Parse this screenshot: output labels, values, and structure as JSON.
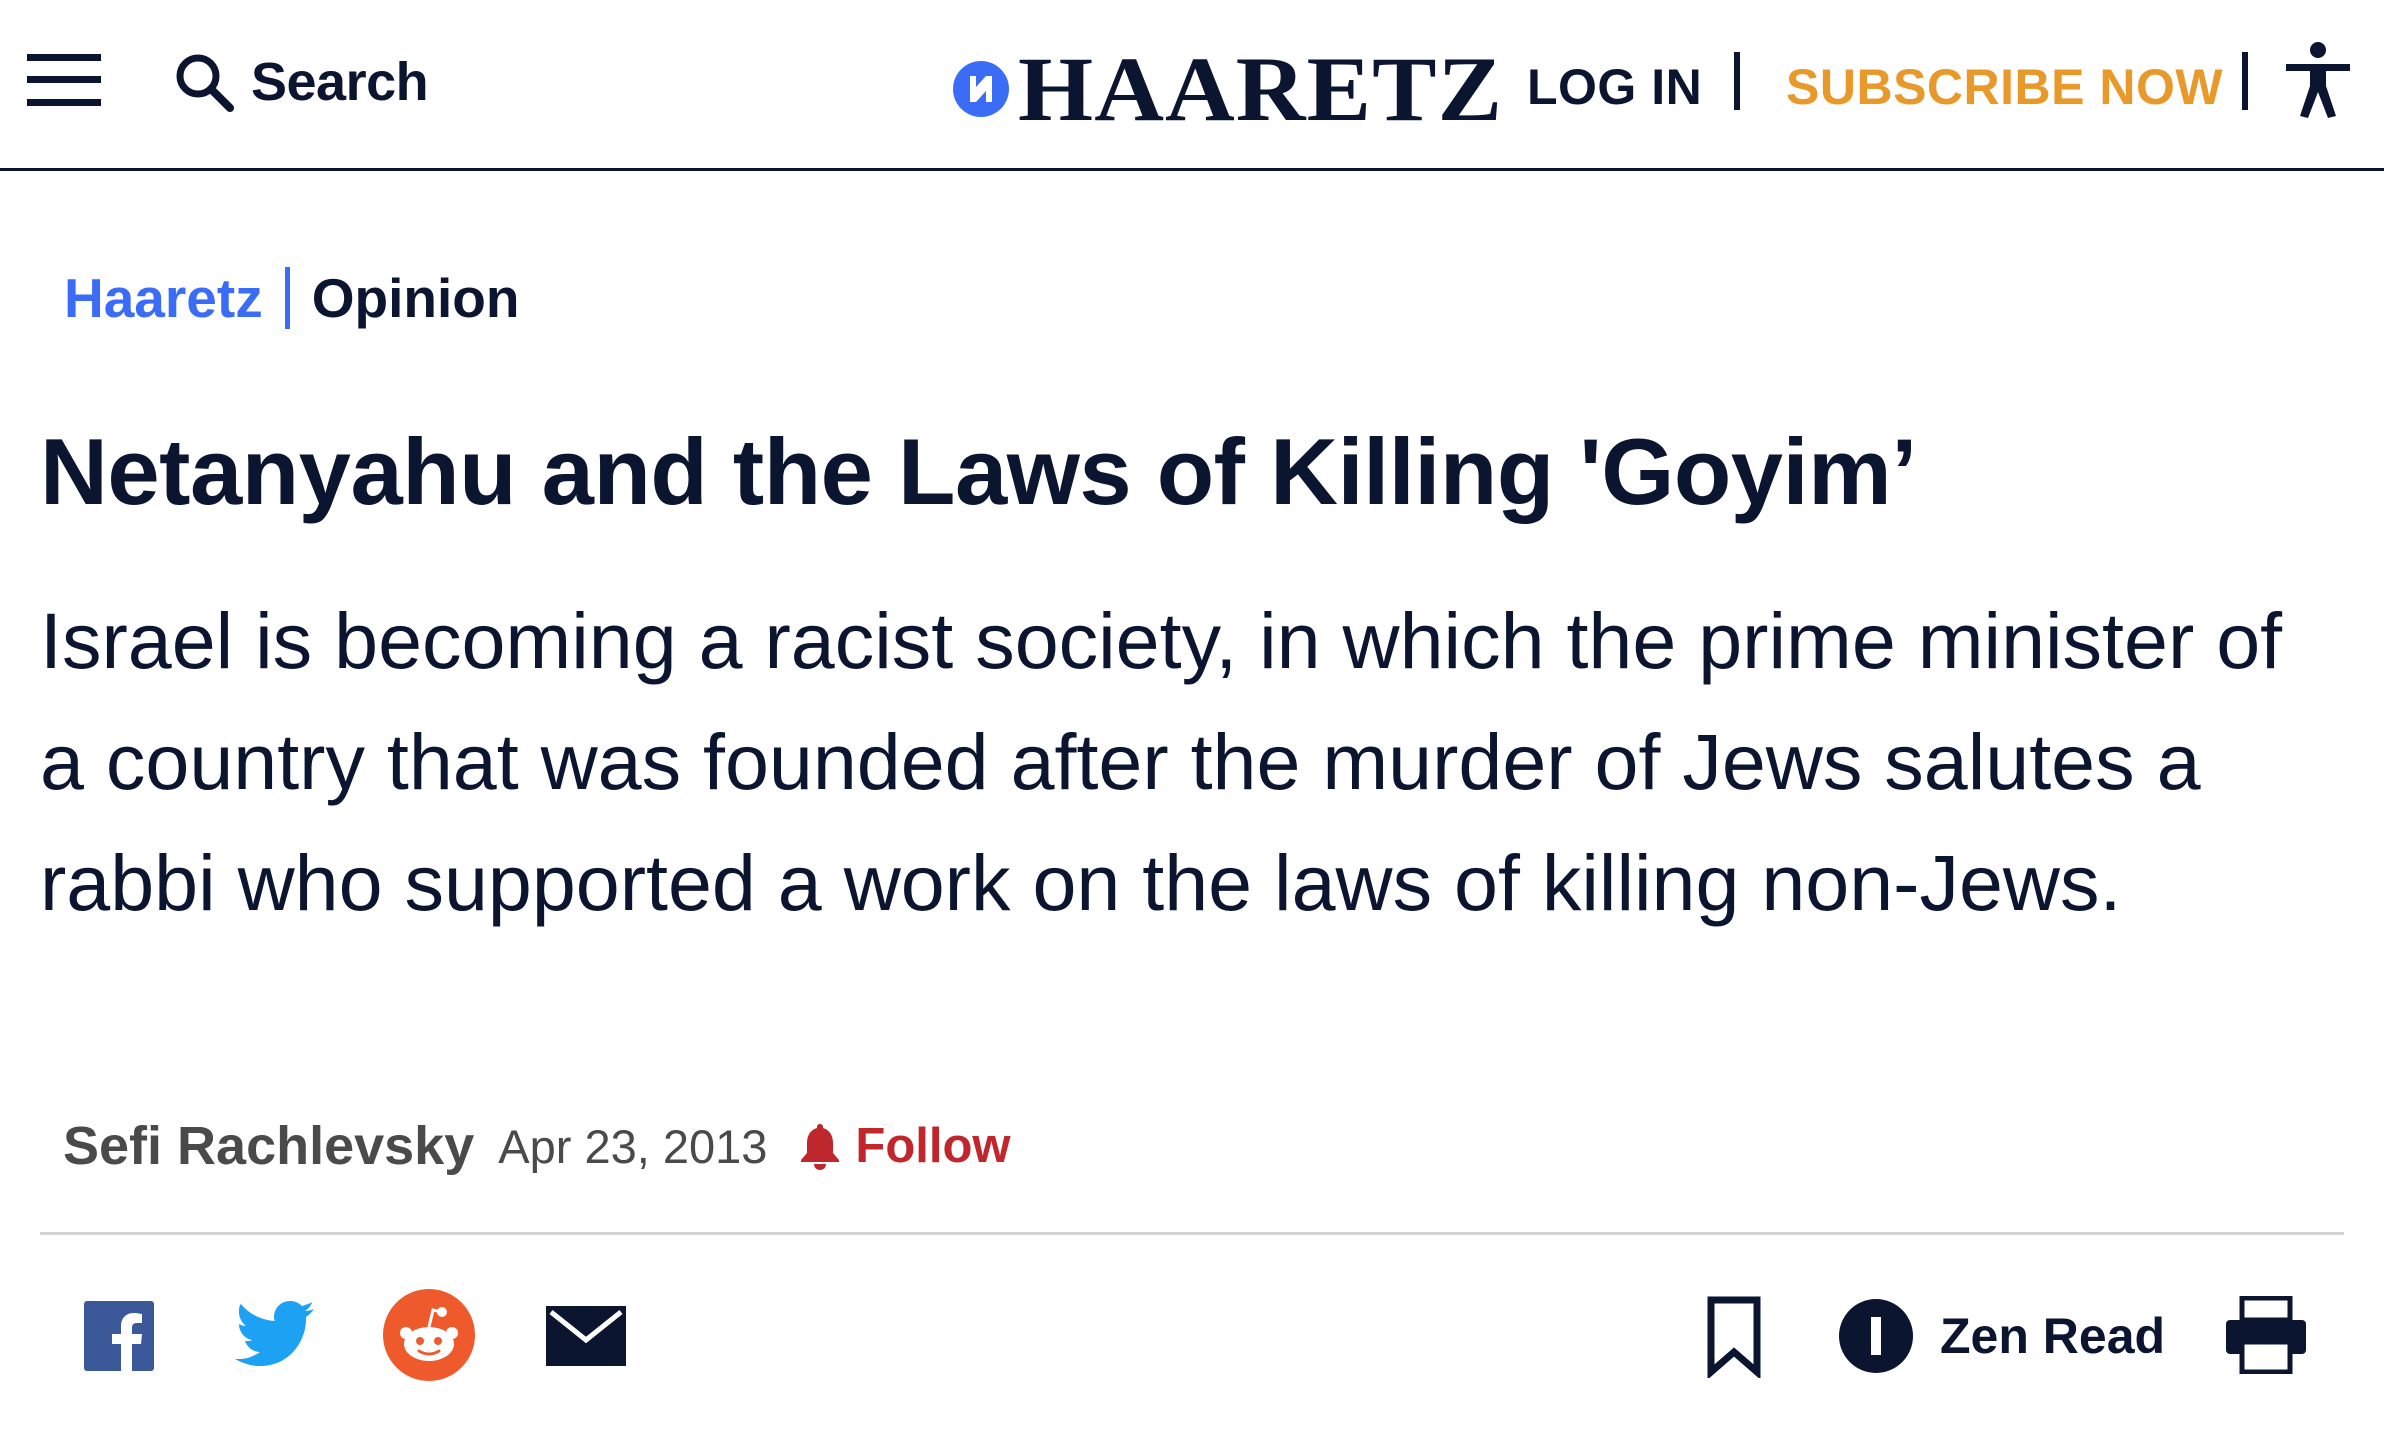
{
  "header": {
    "search_label": "Search",
    "logo_text": "HAARETZ",
    "login_label": "LOG IN",
    "subscribe_label": "SUBSCRIBE NOW",
    "icons": [
      "menu-icon",
      "search-icon",
      "haaretz-logo-icon",
      "accessibility-icon"
    ]
  },
  "breadcrumb": {
    "home": "Haaretz",
    "section": "Opinion"
  },
  "article": {
    "headline": "Netanyahu and the Laws of Killing 'Goyim’",
    "subtitle": "Israel is becoming a racist society, in which the prime minister of a country that was founded after the murder of Jews salutes a rabbi who supported a work on the laws of killing non-Jews.",
    "author": "Sefi Rachlevsky",
    "date": "Apr 23, 2013",
    "follow_label": "Follow"
  },
  "share_bar": {
    "icons": [
      "facebook-icon",
      "twitter-icon",
      "reddit-icon",
      "email-icon",
      "bookmark-icon",
      "zen-read-icon",
      "print-icon"
    ],
    "zen_read_label": "Zen Read"
  },
  "colors": {
    "navy": "#0b1530",
    "link_blue": "#3a6cf5",
    "subscribe_orange": "#e8992a",
    "follow_red": "#c0272d",
    "facebook_blue": "#3b5998",
    "twitter_blue": "#1da1f2",
    "reddit_orange": "#ee5a2b"
  }
}
